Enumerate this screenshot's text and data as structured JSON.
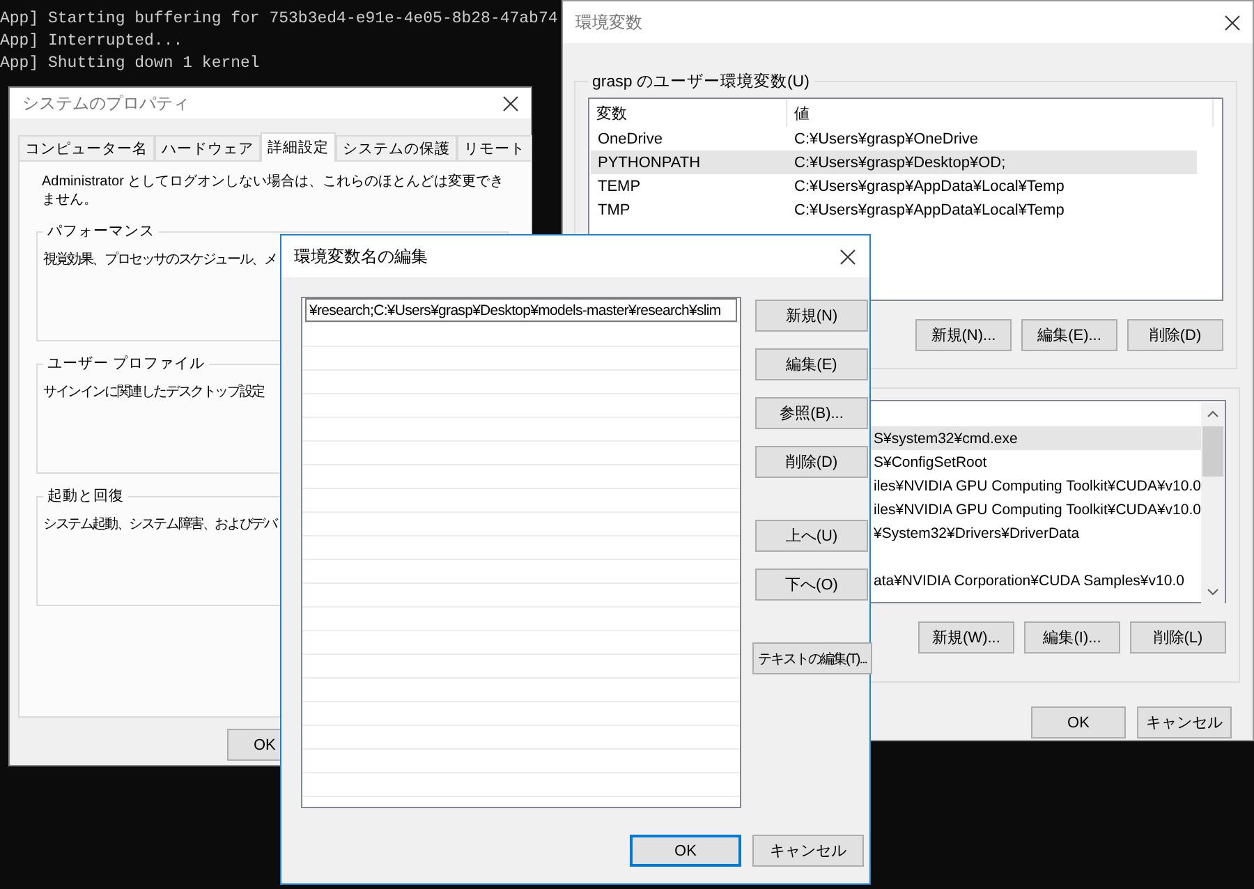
{
  "terminal": {
    "lines": [
      "App] Starting buffering for 753b3ed4-e91e-4e05-8b28-47ab74",
      "App] Interrupted...",
      "App] Shutting down 1 kernel"
    ]
  },
  "env_window": {
    "title": "環境変数",
    "user_group": {
      "label": "grasp のユーザー環境変数(U)",
      "columns": [
        "変数",
        "値"
      ],
      "rows": [
        {
          "name": "OneDrive",
          "value": "C:¥Users¥grasp¥OneDrive",
          "selected": false
        },
        {
          "name": "PYTHONPATH",
          "value": "C:¥Users¥grasp¥Desktop¥OD;",
          "selected": true
        },
        {
          "name": "TEMP",
          "value": "C:¥Users¥grasp¥AppData¥Local¥Temp",
          "selected": false
        },
        {
          "name": "TMP",
          "value": "C:¥Users¥grasp¥AppData¥Local¥Temp",
          "selected": false
        }
      ],
      "buttons": [
        "新規(N)...",
        "編集(E)...",
        "削除(D)"
      ]
    },
    "system_group": {
      "rows": [
        {
          "selected": false
        },
        {
          "value": "S¥system32¥cmd.exe",
          "selected": true
        },
        {
          "value": "S¥ConfigSetRoot",
          "selected": false
        },
        {
          "value": "iles¥NVIDIA GPU Computing Toolkit¥CUDA¥v10.0",
          "selected": false
        },
        {
          "value": "iles¥NVIDIA GPU Computing Toolkit¥CUDA¥v10.0",
          "selected": false
        },
        {
          "value": "¥System32¥Drivers¥DriverData",
          "selected": false
        },
        {
          "selected": false
        },
        {
          "value": "ata¥NVIDIA Corporation¥CUDA Samples¥v10.0",
          "selected": false
        }
      ],
      "buttons": [
        "新規(W)...",
        "編集(I)...",
        "削除(L)"
      ]
    },
    "buttons": [
      "OK",
      "キャンセル"
    ]
  },
  "system_properties": {
    "title": "システムのプロパティ",
    "tabs": [
      {
        "label": "コンピューター名",
        "selected": false
      },
      {
        "label": "ハードウェア",
        "selected": false
      },
      {
        "label": "詳細設定",
        "selected": true
      },
      {
        "label": "システムの保護",
        "selected": false
      },
      {
        "label": "リモート",
        "selected": false
      }
    ],
    "notice": "Administrator としてログオンしない場合は、これらのほとんどは変更できません。",
    "groups": [
      {
        "label": "パフォーマンス",
        "description": "視覚効果、プロセッサのスケジュール、メ"
      },
      {
        "label": "ユーザー プロファイル",
        "description": "サインインに関連したデスクトップ設定"
      },
      {
        "label": "起動と回復",
        "description": "システム起動、システム障害、およびデバ"
      }
    ],
    "buttons": [
      "OK"
    ]
  },
  "edit_dialog": {
    "title": "環境変数名の編集",
    "entries": [
      {
        "value": "¥research;C:¥Users¥grasp¥Desktop¥models-master¥research¥slim",
        "editing": true
      }
    ],
    "side_button_groups": [
      [
        "新規(N)",
        "編集(E)",
        "参照(B)...",
        "削除(D)"
      ],
      [
        "上へ(U)",
        "下へ(O)"
      ],
      [
        "テキストの編集(T)..."
      ]
    ],
    "buttons": [
      {
        "label": "OK",
        "default": true
      },
      {
        "label": "キャンセル",
        "default": false
      }
    ]
  }
}
